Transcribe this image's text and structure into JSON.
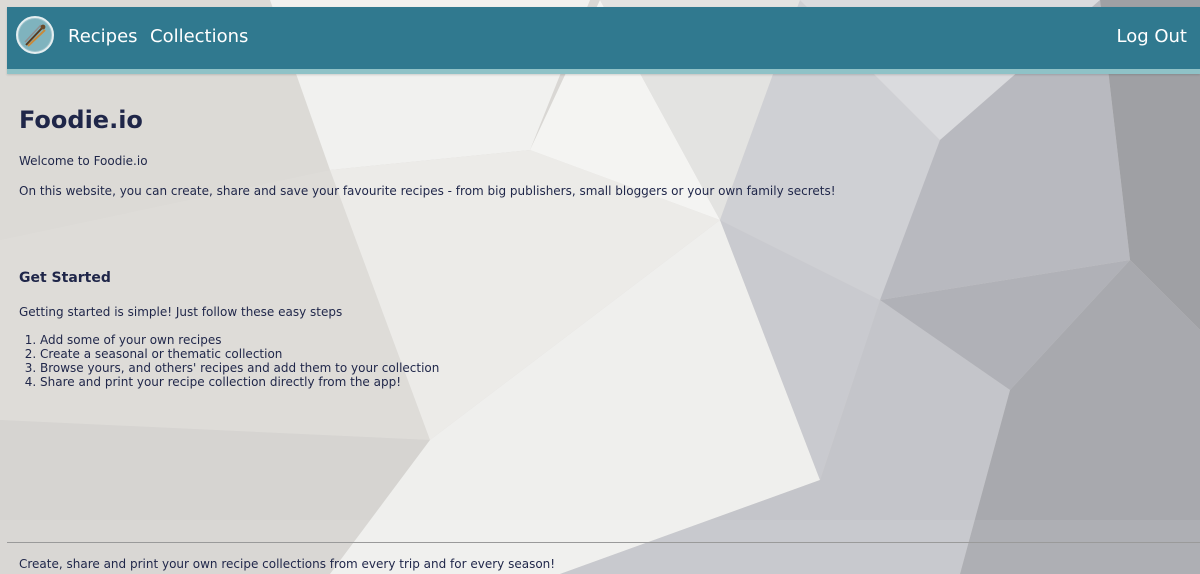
{
  "nav": {
    "logo_icon": "kitchen-utensils-icon",
    "links": [
      "Recipes",
      "Collections"
    ],
    "logout": "Log Out",
    "colors": {
      "bar": "#30798f",
      "accent": "#8fc2c7"
    }
  },
  "main": {
    "title": "Foodie.io",
    "welcome": "Welcome to Foodie.io",
    "intro": "On this website, you can create, share and save your favourite recipes - from big publishers, small bloggers or your own family secrets!",
    "get_started": {
      "heading": "Get Started",
      "lead": "Getting started is simple! Just follow these easy steps",
      "steps": [
        "Add some of your own recipes",
        "Create a seasonal or thematic collection",
        "Browse yours, and others' recipes and add them to your collection",
        "Share and print your recipe collection directly from the app!"
      ]
    }
  },
  "footer": {
    "text": "Create, share and print your own recipe collections from every trip and for every season!"
  }
}
